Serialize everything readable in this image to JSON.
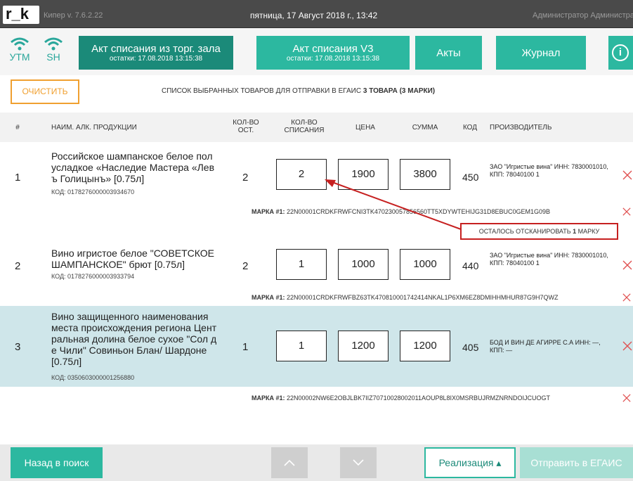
{
  "topbar": {
    "logo": "r_k",
    "version": "Кипер v. 7.6.2.22",
    "datetime": "пятница, 17 Август 2018 г., 13:42",
    "user": "Администратор Администратор"
  },
  "header": {
    "utm_label": "УТМ",
    "sh_label": "SH",
    "btn_writeoff_hall": {
      "title": "Акт списания из торг. зала",
      "sub": "остатки: 17.08.2018 13:15:38"
    },
    "btn_writeoff_v3": {
      "title": "Акт списания V3",
      "sub": "остатки: 17.08.2018 13:15:38"
    },
    "btn_acts": "Акты",
    "btn_journal": "Журнал",
    "info_icon": "i"
  },
  "toolbar": {
    "clear_label": "ОЧИСТИТЬ",
    "list_text": "СПИСОК ВЫБРАННЫХ ТОВАРОВ ДЛЯ ОТПРАВКИ В ЕГАИС",
    "count_text": "3 ТОВАРА",
    "marks_text": "(3 МАРКИ)"
  },
  "columns": {
    "num": "#",
    "name": "НАИМ. АЛК. ПРОДУКЦИИ",
    "rest_1": "КОЛ-ВО",
    "rest_2": "ОСТ.",
    "writeoff_1": "КОЛ-ВО",
    "writeoff_2": "СПИСАНИЯ",
    "price": "ЦЕНА",
    "sum": "СУММА",
    "code": "КОД",
    "producer": "ПРОИЗВОДИТЕЛЬ"
  },
  "rows": [
    {
      "num": "1",
      "name": "Российское шампанское белое пол усладкое «Наследие Мастера «Лев ъ Голицынъ» [0.75л]",
      "code": "КОД: 0178276000003934670",
      "rest": "2",
      "qty": "2",
      "price": "1900",
      "sum": "3800",
      "kod": "450",
      "producer": "ЗАО \"Игристые вина\" ИНН: 7830001010, КПП: 78040100 1",
      "mark_label": "МАРКА #1:",
      "mark": "22N00001CRDKFRWFCNI3TK470230057856560TT5XDYWTEHIJG31D8EBUC0GEM1G09B"
    },
    {
      "num": "2",
      "name": "Вино игристое белое \"СОВЕТСКОЕ ШАМПАНСКОЕ\" брют [0.75л]",
      "code": "КОД: 0178276000003933794",
      "rest": "2",
      "qty": "1",
      "price": "1000",
      "sum": "1000",
      "kod": "440",
      "producer": "ЗАО \"Игристые вина\" ИНН: 7830001010, КПП: 78040100 1",
      "mark_label": "МАРКА #1:",
      "mark": "22N00001CRDKFRWFBZ63TK470810001742414NKAL1P6XM6EZ8DMIHHMHUR87G9H7QWZ"
    },
    {
      "num": "3",
      "name": "Вино защищенного наименования места происхождения региона Цент ральная долина белое сухое \"Сол д е Чили\" Совиньон Блан/ Шардоне [0.75л]",
      "code": "КОД: 0350603000001256880",
      "rest": "1",
      "qty": "1",
      "price": "1200",
      "sum": "1200",
      "kod": "405",
      "producer": "БОД И ВИН ДЕ АГИРРЕ С.А ИНН: —, КПП: —",
      "mark_label": "МАРКА #1:",
      "mark": "22N00002NW6E2OBJLBK7IIZ70710028002011AOUP8L8IX0MSRBUJRMZNRNDOIJCUOGT"
    }
  ],
  "annotation": {
    "prefix": "ОСТАЛОСЬ ОТСКАНИРОВАТЬ",
    "count": "1",
    "suffix": "МАРКУ"
  },
  "footer": {
    "back_label": "Назад в поиск",
    "realization_label": "Реализация ▴",
    "send_label": "Отправить в ЕГАИС"
  },
  "colors": {
    "accent_dark": "#1b8a79",
    "accent": "#2cb8a0",
    "orange": "#f0a030",
    "red": "#c62020"
  }
}
